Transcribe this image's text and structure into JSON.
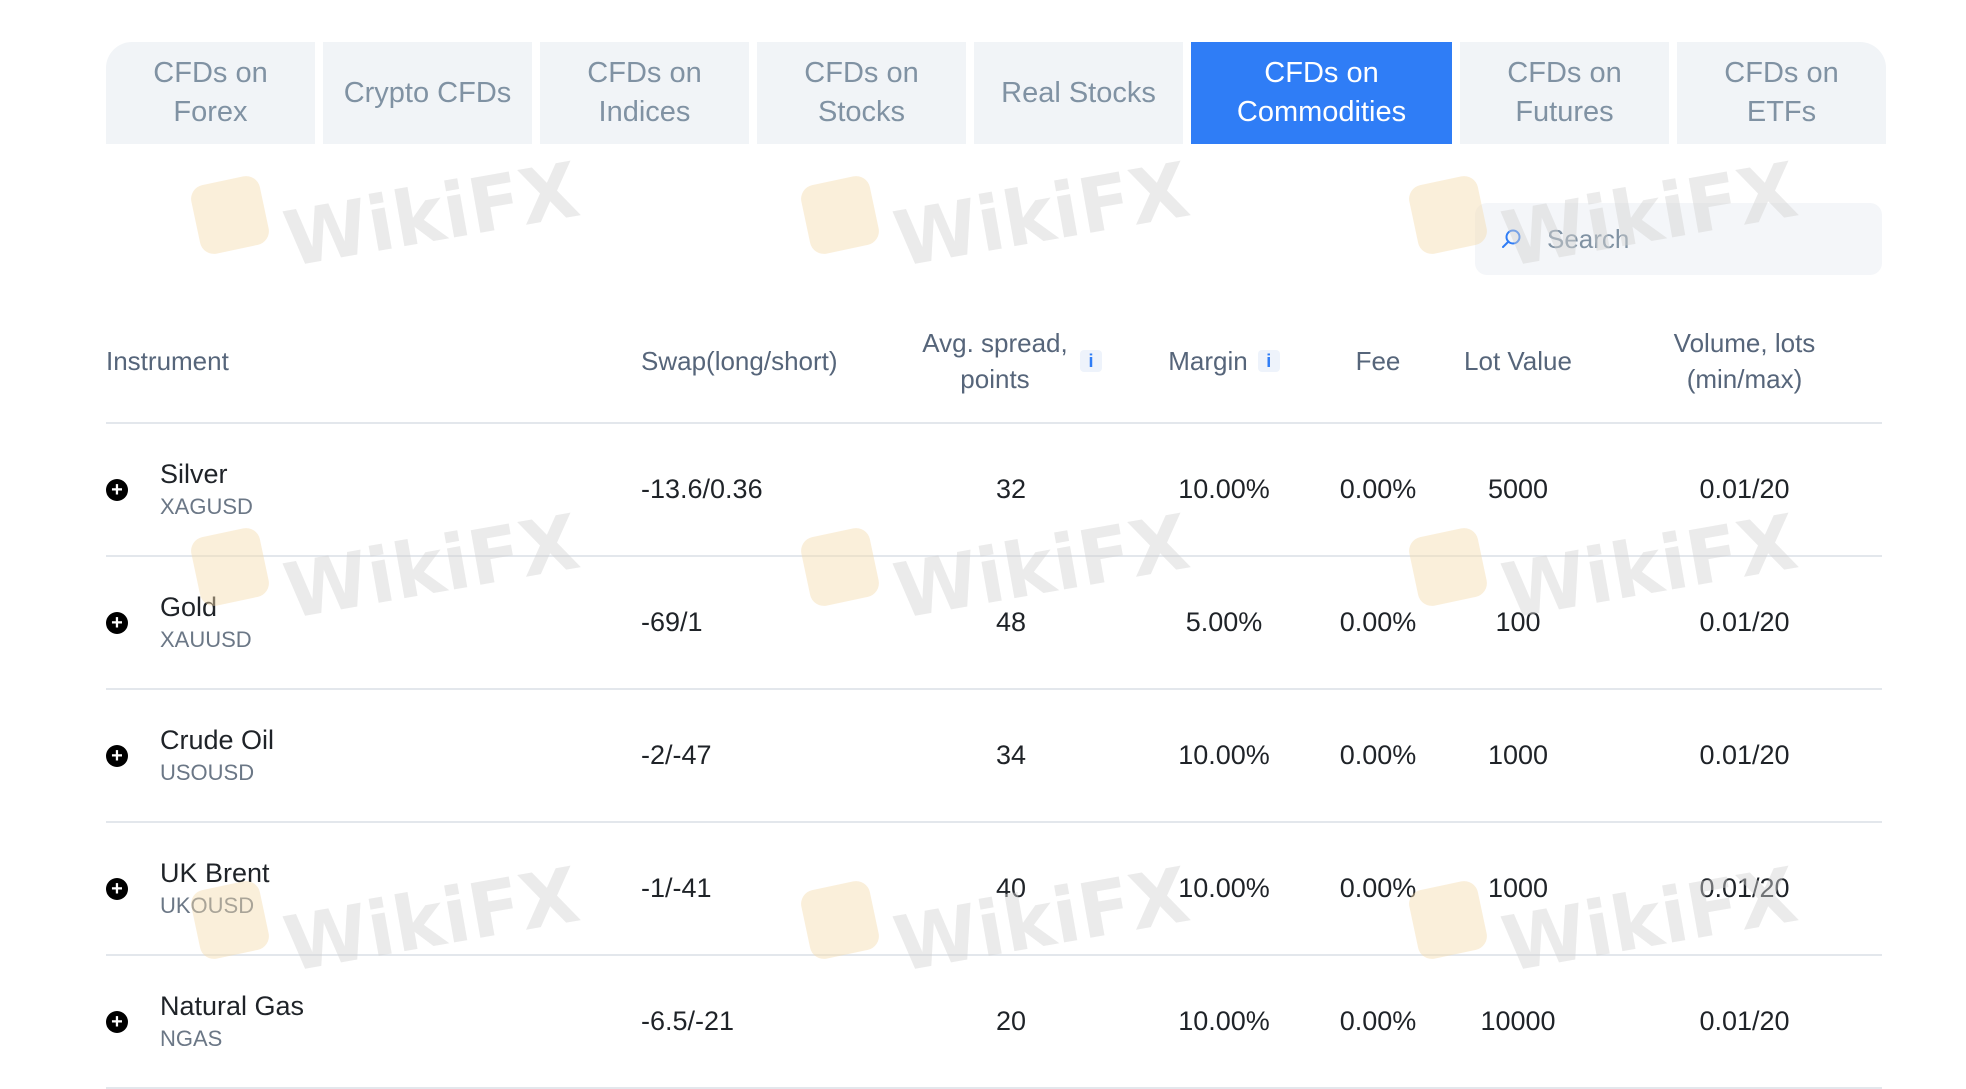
{
  "tabs": [
    {
      "label": "CFDs on Forex",
      "active": false
    },
    {
      "label": "Crypto CFDs",
      "active": false
    },
    {
      "label": "CFDs on Indices",
      "active": false
    },
    {
      "label": "CFDs on Stocks",
      "active": false
    },
    {
      "label": "Real Stocks",
      "active": false
    },
    {
      "label": "CFDs on Commodities",
      "active": true
    },
    {
      "label": "CFDs on Futures",
      "active": false
    },
    {
      "label": "CFDs on ETFs",
      "active": false
    }
  ],
  "search": {
    "placeholder": "Search",
    "value": "",
    "icon": "search-icon"
  },
  "table": {
    "headers": {
      "instrument": "Instrument",
      "swap": "Swap(long/short)",
      "spread": "Avg. spread, points",
      "margin": "Margin",
      "fee": "Fee",
      "lot_value": "Lot Value",
      "volume": "Volume, lots (min/max)"
    },
    "info_glyph": "i",
    "expand_glyph": "+",
    "rows": [
      {
        "name": "Silver",
        "code": "XAGUSD",
        "swap": "-13.6/0.36",
        "spread": "32",
        "margin": "10.00%",
        "fee": "0.00%",
        "lot_value": "5000",
        "volume": "0.01/20"
      },
      {
        "name": "Gold",
        "code": "XAUUSD",
        "swap": "-69/1",
        "spread": "48",
        "margin": "5.00%",
        "fee": "0.00%",
        "lot_value": "100",
        "volume": "0.01/20"
      },
      {
        "name": "Crude Oil",
        "code": "USOUSD",
        "swap": "-2/-47",
        "spread": "34",
        "margin": "10.00%",
        "fee": "0.00%",
        "lot_value": "1000",
        "volume": "0.01/20"
      },
      {
        "name": "UK Brent",
        "code": "UKOUSD",
        "swap": "-1/-41",
        "spread": "40",
        "margin": "10.00%",
        "fee": "0.00%",
        "lot_value": "1000",
        "volume": "0.01/20"
      },
      {
        "name": "Natural Gas",
        "code": "NGAS",
        "swap": "-6.5/-21",
        "spread": "20",
        "margin": "10.00%",
        "fee": "0.00%",
        "lot_value": "10000",
        "volume": "0.01/20"
      }
    ]
  },
  "watermark": {
    "text": "WikiFX"
  },
  "colors": {
    "accent": "#2f7df6",
    "tab_bg": "#f1f4f7",
    "tab_text": "#8092a3"
  }
}
